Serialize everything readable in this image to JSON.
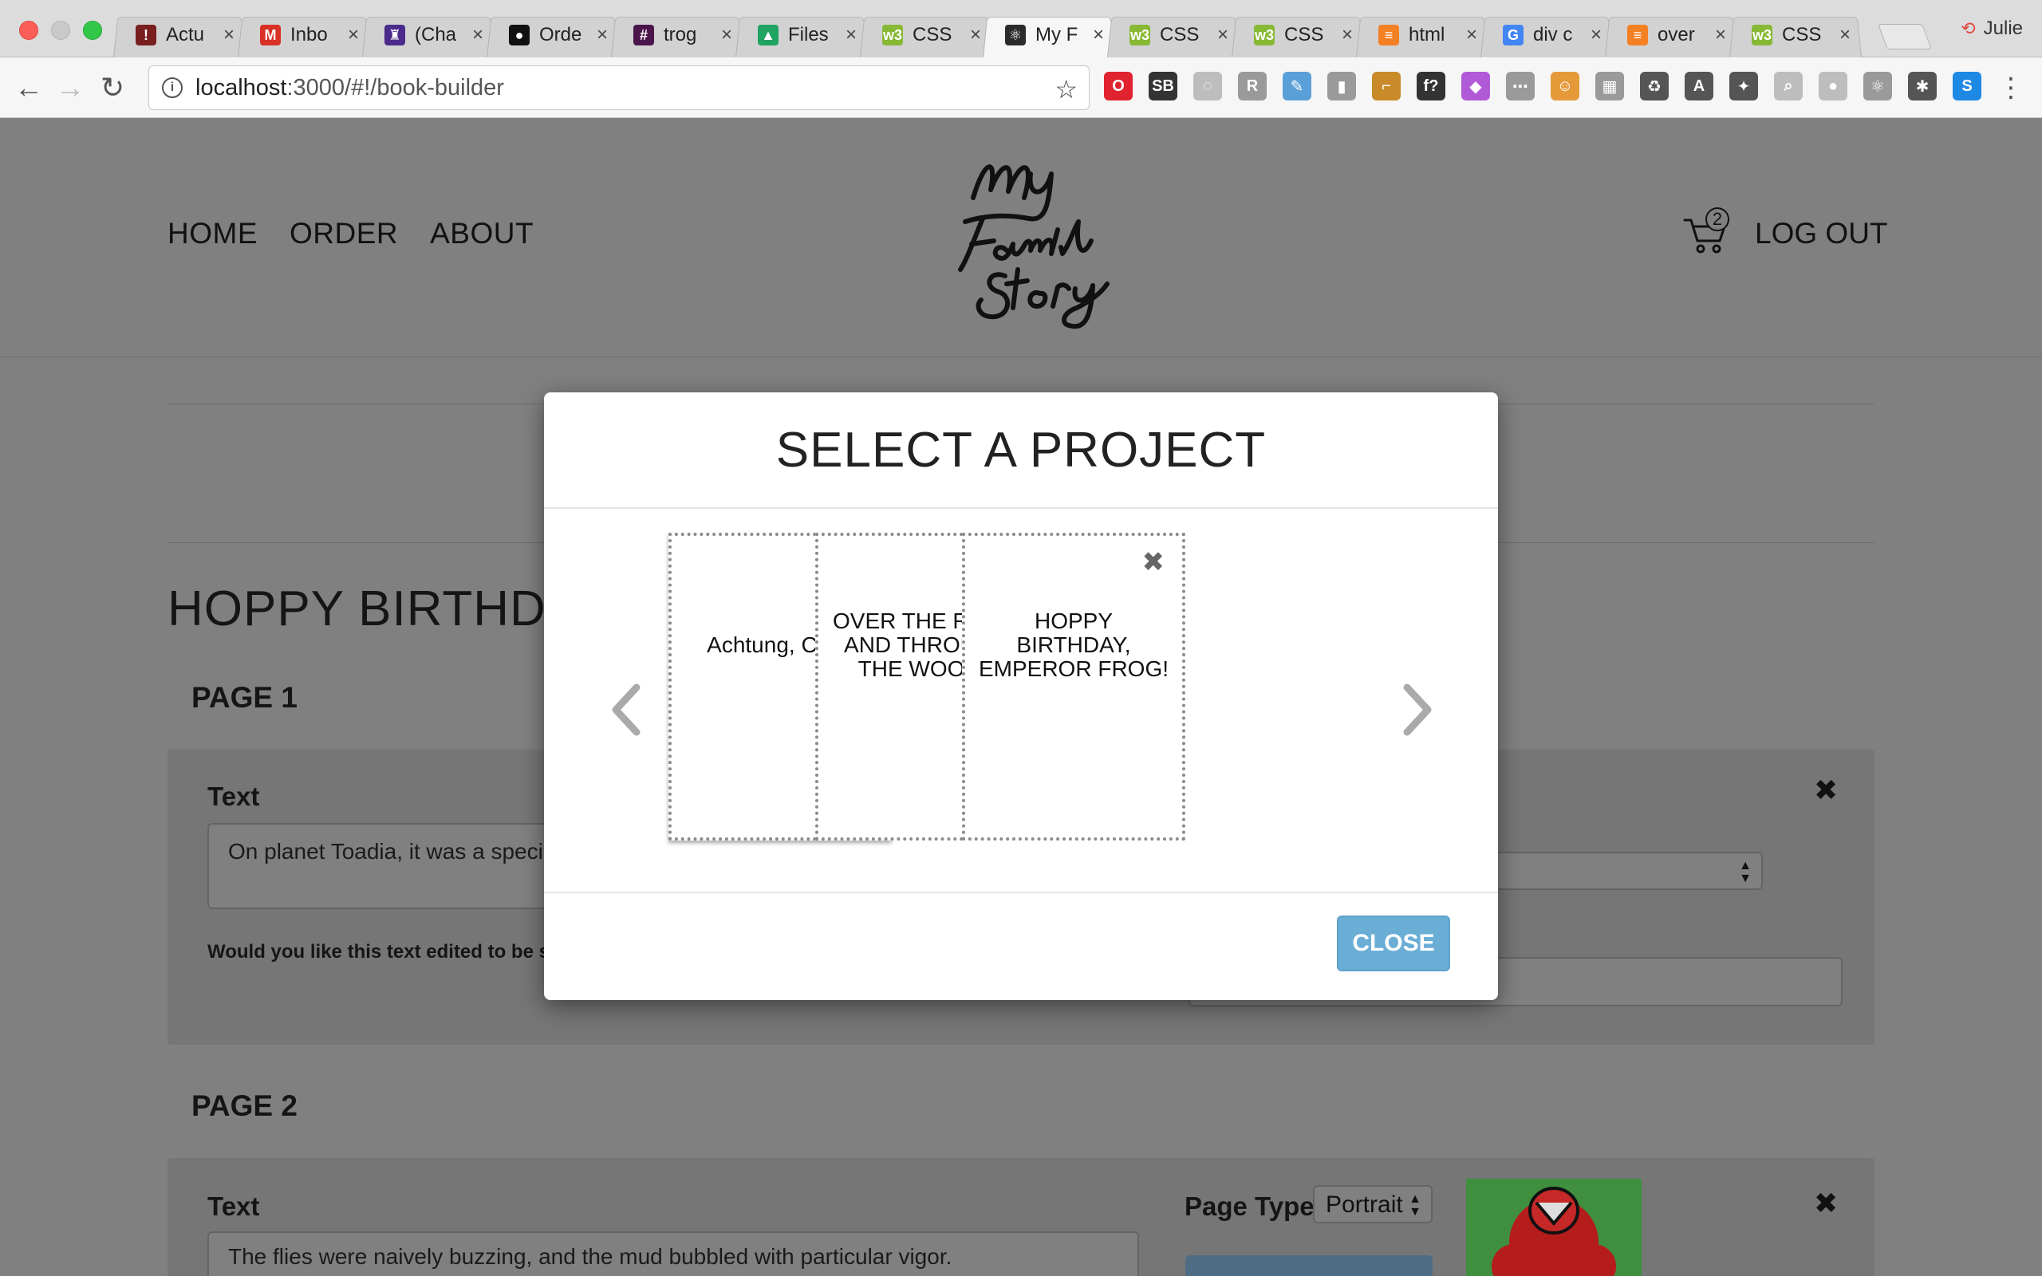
{
  "browser": {
    "tabs": [
      {
        "title": "Actu",
        "favicon_color": "#7a1f1f",
        "favicon_glyph": "!"
      },
      {
        "title": "Inbo",
        "favicon_color": "#d93025",
        "favicon_glyph": "M"
      },
      {
        "title": "(Cha",
        "favicon_color": "#4a2a8a",
        "favicon_glyph": "♜"
      },
      {
        "title": "Orde",
        "favicon_color": "#111111",
        "favicon_glyph": "●"
      },
      {
        "title": "trog",
        "favicon_color": "#4a154b",
        "favicon_glyph": "#"
      },
      {
        "title": "Files",
        "favicon_color": "#1fa463",
        "favicon_glyph": "▲"
      },
      {
        "title": "CSS",
        "favicon_color": "#88b935",
        "favicon_glyph": "w3"
      },
      {
        "title": "My F",
        "favicon_color": "#2b2b2b",
        "favicon_glyph": "⚛"
      },
      {
        "title": "CSS",
        "favicon_color": "#88b935",
        "favicon_glyph": "w3"
      },
      {
        "title": "CSS",
        "favicon_color": "#88b935",
        "favicon_glyph": "w3"
      },
      {
        "title": "html",
        "favicon_color": "#f48024",
        "favicon_glyph": "≡"
      },
      {
        "title": "div c",
        "favicon_color": "#4285f4",
        "favicon_glyph": "G"
      },
      {
        "title": "over",
        "favicon_color": "#f48024",
        "favicon_glyph": "≡"
      },
      {
        "title": "CSS",
        "favicon_color": "#88b935",
        "favicon_glyph": "w3"
      }
    ],
    "active_tab_index": 7,
    "profile_name": "Julie",
    "url_host": "localhost",
    "url_rest": ":3000/#!/book-builder",
    "extensions": [
      {
        "name": "opera-icon",
        "color": "#e0232e",
        "glyph": "O"
      },
      {
        "name": "sb-icon",
        "color": "#333333",
        "glyph": "SB"
      },
      {
        "name": "swirl-icon",
        "color": "#bdbdbd",
        "glyph": "◌"
      },
      {
        "name": "r-icon",
        "color": "#9a9a9a",
        "glyph": "R"
      },
      {
        "name": "eyedropper-icon",
        "color": "#5aa0d8",
        "glyph": "✎"
      },
      {
        "name": "ruler-icon",
        "color": "#9a9a9a",
        "glyph": "▮"
      },
      {
        "name": "angle-ruler-icon",
        "color": "#c98a2a",
        "glyph": "⌐"
      },
      {
        "name": "font-icon",
        "color": "#333333",
        "glyph": "f?"
      },
      {
        "name": "paint-icon",
        "color": "#b05ad8",
        "glyph": "◆"
      },
      {
        "name": "code-icon",
        "color": "#9a9a9a",
        "glyph": "⋯"
      },
      {
        "name": "face-icon",
        "color": "#e59a3a",
        "glyph": "☺"
      },
      {
        "name": "layout-icon",
        "color": "#9a9a9a",
        "glyph": "▦"
      },
      {
        "name": "recycle-icon",
        "color": "#555555",
        "glyph": "♻"
      },
      {
        "name": "angular-icon",
        "color": "#555555",
        "glyph": "A"
      },
      {
        "name": "lightbulb-icon",
        "color": "#555555",
        "glyph": "✦"
      },
      {
        "name": "magnifier-icon",
        "color": "#bdbdbd",
        "glyph": "⌕"
      },
      {
        "name": "pin-icon",
        "color": "#bdbdbd",
        "glyph": "●"
      },
      {
        "name": "react-icon",
        "color": "#9a9a9a",
        "glyph": "⚛"
      },
      {
        "name": "bug-icon",
        "color": "#555555",
        "glyph": "✱"
      },
      {
        "name": "s-icon",
        "color": "#1e88e5",
        "glyph": "S"
      }
    ]
  },
  "site": {
    "nav": [
      "HOME",
      "ORDER",
      "ABOUT"
    ],
    "logo_text": "My Family Story",
    "cart_count": "2",
    "logout_label": "LOG OUT"
  },
  "builder": {
    "book_title": "HOPPY BIRTHDAY, EMPEROR FROG!",
    "pages": [
      {
        "heading": "PAGE 1",
        "text_label": "Text",
        "text_value": "On planet Toadia, it was a special day.",
        "question": "Would you like this text edited to be simpler?"
      },
      {
        "heading": "PAGE 2",
        "text_label": "Text",
        "text_value": "The flies were naively buzzing, and the mud bubbled with particular vigor.",
        "page_type_label": "Page Type",
        "page_type_value": "Portrait"
      }
    ]
  },
  "modal": {
    "title": "SELECT A PROJECT",
    "projects": [
      {
        "name": "Achtung, Cutie",
        "selected": true
      },
      {
        "name": "OVER THE RIVER AND THROUGH THE WOODS",
        "selected": false
      },
      {
        "name": "HOPPY BIRTHDAY, EMPEROR FROG!",
        "selected": false
      }
    ],
    "close_label": "CLOSE",
    "accent_color": "#6aaed6"
  }
}
